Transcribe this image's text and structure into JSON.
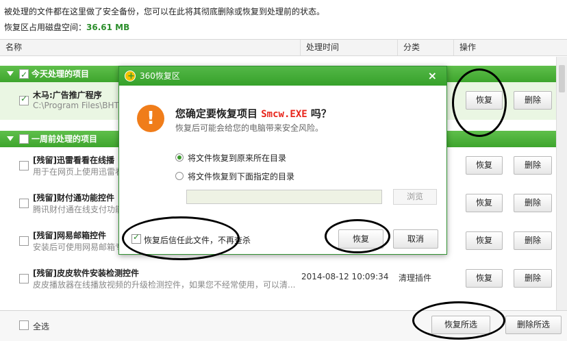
{
  "info": {
    "line1": "被处理的文件都在这里做了安全备份，您可以在此将其彻底删除或恢复到处理前的状态。",
    "disk_label": "恢复区占用磁盘空间：",
    "disk_value": "36.61 MB"
  },
  "columns": [
    "名称",
    "处理时间",
    "分类",
    "操作"
  ],
  "groups": [
    {
      "title": "今天处理的项目",
      "checked": true
    },
    {
      "title": "一周前处理的项目",
      "checked": false
    }
  ],
  "rows": [
    {
      "name": "木马:广告推广程序",
      "desc": "C:\\Program Files\\BHTSe",
      "time": "",
      "category": "",
      "checked": true
    },
    {
      "name": "[残留]迅雷看看在线播",
      "desc": "用于在网页上使用迅雷看",
      "time": "",
      "category": "",
      "checked": false
    },
    {
      "name": "[残留]财付通功能控件",
      "desc": "腾讯财付通在线支付功能",
      "time": "",
      "category": "",
      "checked": false
    },
    {
      "name": "[残留]网易邮箱控件",
      "desc": "安装后可使用网易邮箱专",
      "time": "",
      "category": "",
      "checked": false
    },
    {
      "name": "[残留]皮皮软件安装检测控件",
      "desc": "皮皮播放器在线播放视频的升级检测控件，如果您不经常使用，可以清...",
      "time": "2014-08-12 10:09:34",
      "category": "清理插件",
      "checked": false
    }
  ],
  "row_buttons": {
    "restore": "恢复",
    "delete": "删除"
  },
  "footer": {
    "select_all": "全选",
    "restore_selected": "恢复所选",
    "delete_selected": "删除所选"
  },
  "dialog": {
    "title": "360恢复区",
    "close": "×",
    "icon": "warning-icon",
    "question_prefix": "您确定要恢复项目",
    "filename": "Smcw.EXE",
    "question_suffix": "吗？",
    "warning": "恢复后可能会给您的电脑带来安全风险。",
    "option_original": "将文件恢复到原来所在目录",
    "option_custom": "将文件恢复到下面指定的目录",
    "selected_option": "original",
    "path_value": "",
    "browse": "浏览",
    "trust_label": "恢复后信任此文件，不再查杀",
    "trust_checked": true,
    "ok": "恢复",
    "cancel": "取消"
  },
  "colors": {
    "accent_green": "#3ea52d",
    "warning_orange": "#f07d1a",
    "filename_red": "#e8251b"
  }
}
